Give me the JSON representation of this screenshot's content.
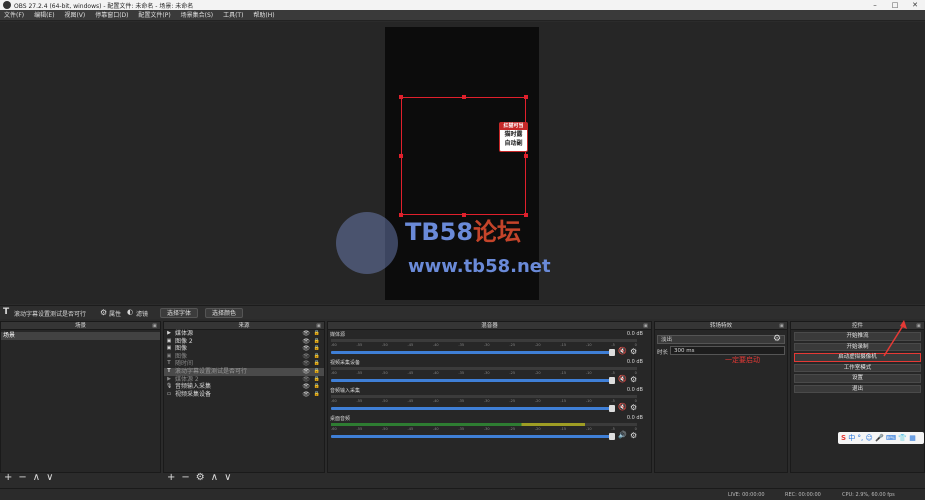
{
  "window": {
    "title": "OBS 27.2.4 (64-bit, windows) - 配置文件: 未命名 - 场景: 未命名"
  },
  "menu": [
    "文件(F)",
    "编辑(E)",
    "视图(V)",
    "停靠窗口(D)",
    "配置文件(P)",
    "场景集合(S)",
    "工具(T)",
    "帮助(H)"
  ],
  "preview": {
    "ad_lines": [
      "红猫可当",
      "猫时露",
      "自动副"
    ],
    "watermark": {
      "brand": "TB58",
      "brand_cn": "论坛",
      "url": "www.tb58.net"
    }
  },
  "source_toolbar": {
    "selected": "滚动字幕设置测试是否可行",
    "properties": "属性",
    "filters": "滤镜",
    "select_font": "选择字体",
    "select_color": "选择颜色"
  },
  "scenes": {
    "title": "场景",
    "items": [
      "场景"
    ]
  },
  "sources": {
    "title": "来源",
    "items": [
      {
        "name": "媒体源",
        "icon": "play-icon",
        "state": "normal"
      },
      {
        "name": "图像 2",
        "icon": "image-icon",
        "state": "normal"
      },
      {
        "name": "图像",
        "icon": "image-icon",
        "state": "normal"
      },
      {
        "name": "图像",
        "icon": "image-icon",
        "state": "dim"
      },
      {
        "name": "随时间",
        "icon": "text-icon",
        "state": "dim"
      },
      {
        "name": "滚动字幕设置测试是否可行",
        "icon": "text-icon",
        "state": "selected"
      },
      {
        "name": "媒体源 2",
        "icon": "play-icon",
        "state": "dim"
      },
      {
        "name": "音频输入采集",
        "icon": "mic-icon",
        "state": "normal"
      },
      {
        "name": "视频采集设备",
        "icon": "camera-icon",
        "state": "normal"
      }
    ]
  },
  "mixer": {
    "title": "混音器",
    "channels": [
      {
        "name": "媒体源",
        "db": "0.0 dB",
        "muted": true,
        "level": 0
      },
      {
        "name": "视频采集设备",
        "db": "0.0 dB",
        "muted": true,
        "level": 0
      },
      {
        "name": "音频输入采集",
        "db": "0.0 dB",
        "muted": true,
        "level": 0
      },
      {
        "name": "桌面音频",
        "db": "0.0 dB",
        "muted": false,
        "level": 0.83
      }
    ],
    "ticks": [
      "-60",
      "-55",
      "-50",
      "-45",
      "-40",
      "-35",
      "-30",
      "-25",
      "-20",
      "-15",
      "-10",
      "-5",
      "0"
    ]
  },
  "transition": {
    "title": "转场特效",
    "type": "淡出",
    "duration_label": "时长",
    "duration": "300 ms"
  },
  "controls": {
    "title": "控件",
    "buttons": [
      "开始推流",
      "开始录制",
      "启动虚拟摄像机",
      "工作室模式",
      "设置",
      "退出"
    ],
    "highlight_index": 2,
    "annotation": "一定要启动"
  },
  "status": {
    "live": "LIVE: 00:00:00",
    "rec": "REC: 00:00:00",
    "cpu": "CPU: 2.9%, 60.00 fps"
  },
  "ime": {
    "label": "中",
    "items": [
      "°,",
      "☺",
      "🎤",
      "⌨",
      "👕",
      "▦"
    ]
  },
  "colors": {
    "selection": "#e0202c",
    "accent_blue": "#3f7fd6",
    "annotation_red": "#e53935",
    "meter_green": "#2e7d32",
    "meter_yellow": "#9e9d24"
  }
}
